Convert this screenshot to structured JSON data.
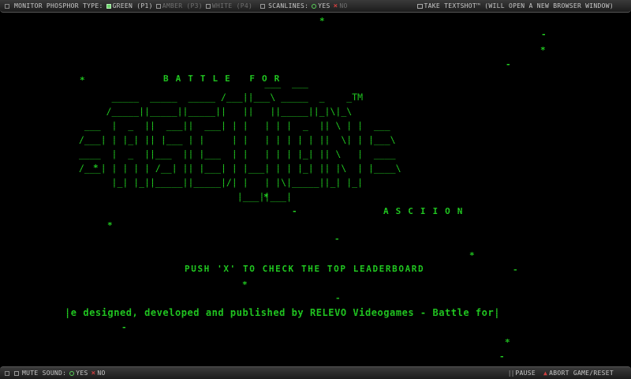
{
  "top_bar": {
    "phosphor_label": "MONITOR PHOSPHOR TYPE:",
    "phosphor_options": [
      {
        "label": "GREEN (P1)",
        "selected": true
      },
      {
        "label": "AMBER (P3)",
        "selected": false
      },
      {
        "label": "WHITE (P4)",
        "selected": false
      }
    ],
    "scanlines_label": "SCANLINES:",
    "scanlines_yes": "YES",
    "scanlines_no": "NO",
    "textshot_label": "TAKE TEXTSHOT™ (WILL OPEN A NEW BROWSER WINDOW)"
  },
  "bottom_bar": {
    "mute_label": "MUTE SOUND:",
    "mute_yes": "YES",
    "mute_no": "NO",
    "pause_label": "PAUSE",
    "abort_label": "ABORT GAME/RESET"
  },
  "game": {
    "title_top": "BATTLE FOR",
    "title_bottom": "ASCIION",
    "logo_ascii": "                                  ___  ___\n      _____  _____  _____ /___||___\\ _____  _    _TM\n     /_____||_____||_____||   ||   ||_____||_|\\|_\\\n ___  |  _  ||  ___||  ___| | |   | | |  _  || \\ | |  ___\n/___| | |_| || |___ | |     | |   | | | | | ||  \\| | |___\\\n____  |  _  ||___  || |___  | |   | | | |_| || \\   |  ____\n/___| | | | | /__| || |___| | |___| | | |_| || |\\  | |____\\\n      |_| |_||_____||_____|/| |   | |\\|_____||_| |_|\n                             |___||___|",
    "leaderboard_prompt": "PUSH 'X' TO CHECK THE TOP LEADERBOARD",
    "credits_text": "|e designed, developed and published by RELEVO Videogames - Battle for|",
    "star_char": "*",
    "dot_char": "-"
  },
  "colors": {
    "phosphor_green": "#22d022",
    "background": "#000000",
    "bar_text": "#c8c8c8",
    "no_mark": "#d04040"
  }
}
